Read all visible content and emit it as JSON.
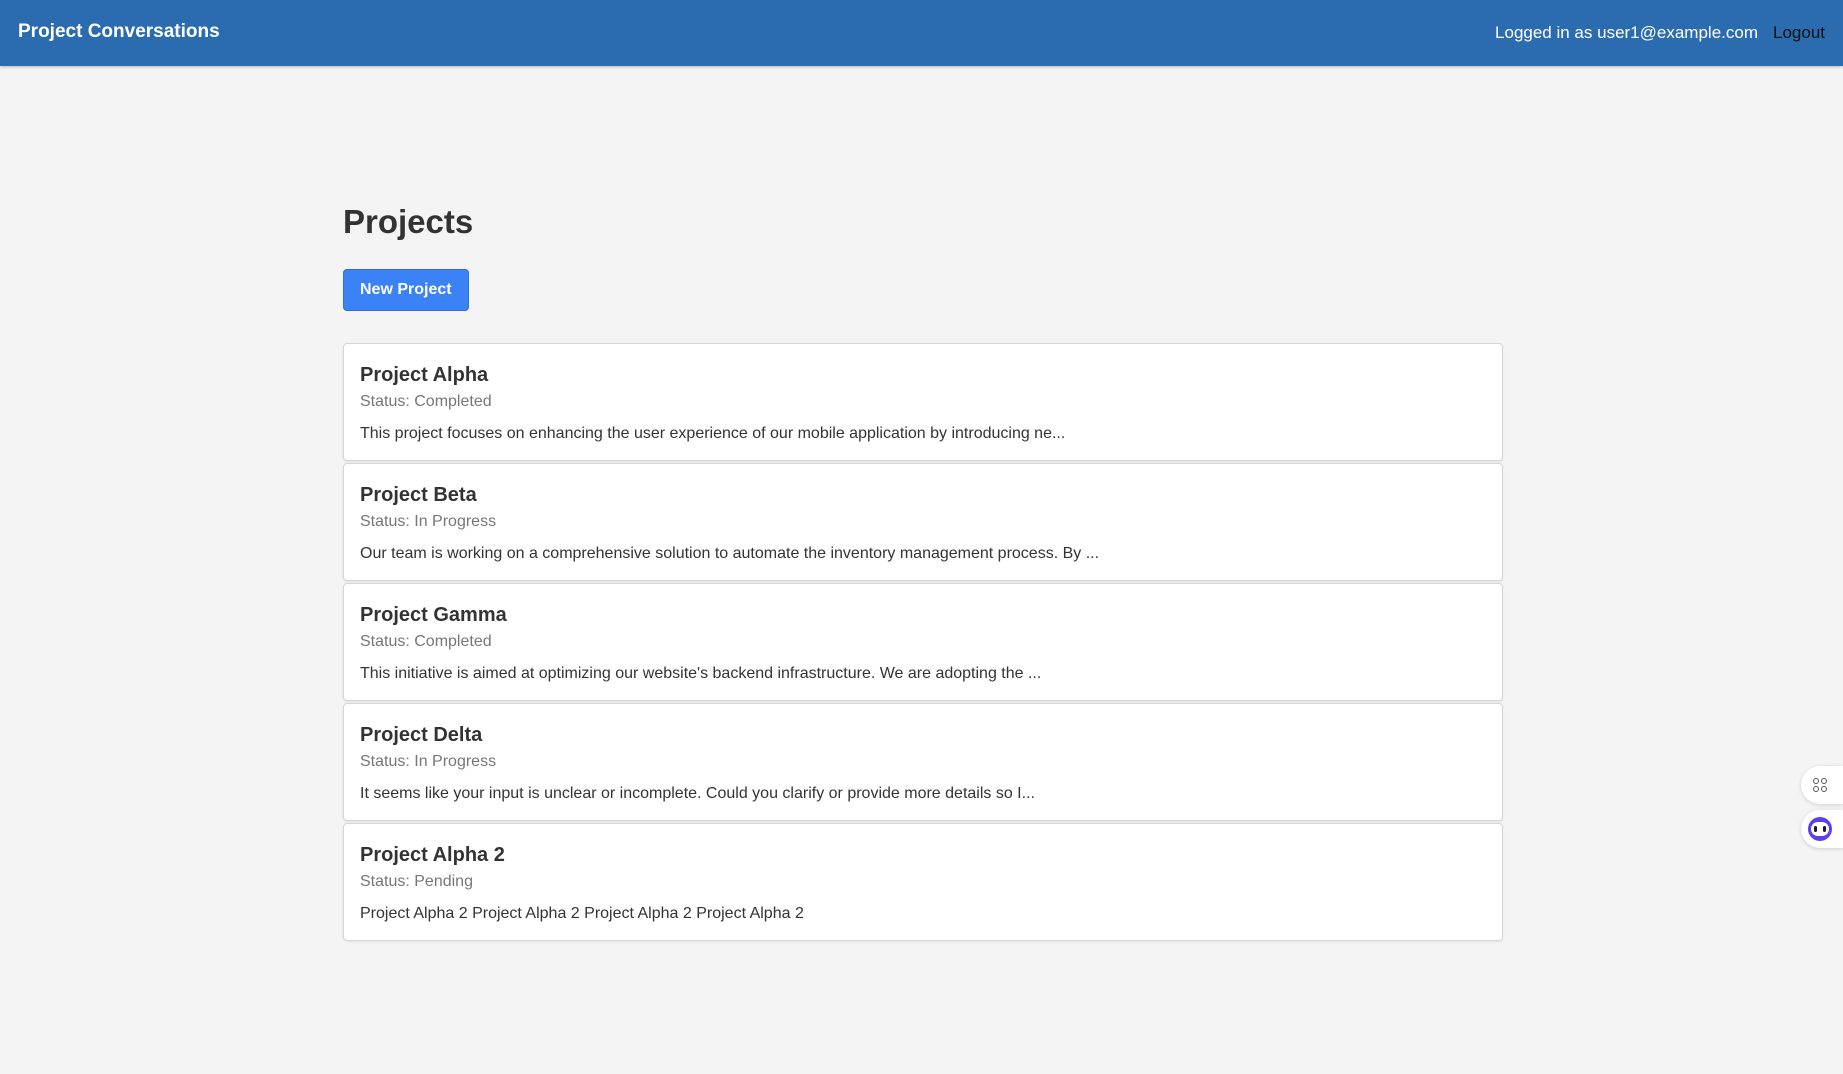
{
  "header": {
    "brand": "Project Conversations",
    "logged_in_text": "Logged in as user1@example.com",
    "logout_label": "Logout"
  },
  "main": {
    "title": "Projects",
    "new_project_label": "New Project",
    "projects": [
      {
        "name": "Project Alpha",
        "status": "Status: Completed",
        "description": "This project focuses on enhancing the user experience of our mobile application by introducing ne..."
      },
      {
        "name": "Project Beta",
        "status": "Status: In Progress",
        "description": "Our team is working on a comprehensive solution to automate the inventory management process. By ..."
      },
      {
        "name": "Project Gamma",
        "status": "Status: Completed",
        "description": "This initiative is aimed at optimizing our website's backend infrastructure. We are adopting the ..."
      },
      {
        "name": "Project Delta",
        "status": "Status: In Progress",
        "description": "It seems like your input is unclear or incomplete. Could you clarify or provide more details so I..."
      },
      {
        "name": "Project Alpha 2",
        "status": "Status: Pending",
        "description": "Project Alpha 2 Project Alpha 2 Project Alpha 2 Project Alpha 2"
      }
    ]
  },
  "floating_tools": {
    "icons": [
      "apps-grid-icon",
      "assistant-bot-icon"
    ]
  },
  "colors": {
    "header_bg": "#2b6cb0",
    "page_bg": "#f4f4f4",
    "primary_button": "#3b82f6"
  }
}
